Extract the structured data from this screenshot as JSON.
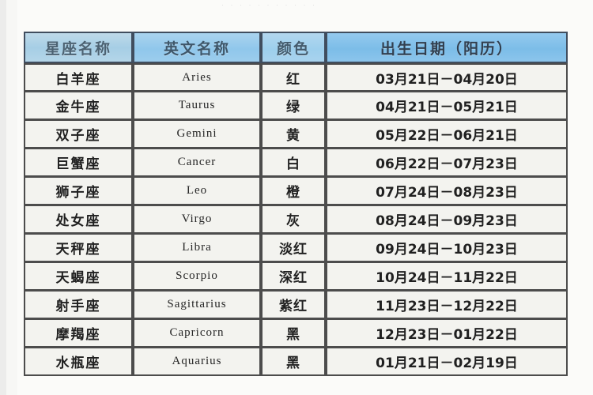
{
  "page": {
    "top_artifact_text": "· · · · ·    · ·    · · · ·",
    "background_color": "#fbfbf9",
    "header_accent_color": "#7dbeea",
    "grid_line_color": "#4a4a4a"
  },
  "table": {
    "headers": {
      "name": "星座名称",
      "english": "英文名称",
      "color": "颜色",
      "date": "出生日期（阳历）"
    },
    "rows": [
      {
        "name": "白羊座",
        "english": "Aries",
        "color": "红",
        "date": "03月21日－04月20日"
      },
      {
        "name": "金牛座",
        "english": "Taurus",
        "color": "绿",
        "date": "04月21日－05月21日"
      },
      {
        "name": "双子座",
        "english": "Gemini",
        "color": "黄",
        "date": "05月22日－06月21日"
      },
      {
        "name": "巨蟹座",
        "english": "Cancer",
        "color": "白",
        "date": "06月22日－07月23日"
      },
      {
        "name": "狮子座",
        "english": "Leo",
        "color": "橙",
        "date": "07月24日－08月23日"
      },
      {
        "name": "处女座",
        "english": "Virgo",
        "color": "灰",
        "date": "08月24日－09月23日"
      },
      {
        "name": "天秤座",
        "english": "Libra",
        "color": "淡红",
        "date": "09月24日－10月23日"
      },
      {
        "name": "天蝎座",
        "english": "Scorpio",
        "color": "深红",
        "date": "10月24日－11月22日"
      },
      {
        "name": "射手座",
        "english": "Sagittarius",
        "color": "紫红",
        "date": "11月23日－12月22日"
      },
      {
        "name": "摩羯座",
        "english": "Capricorn",
        "color": "黑",
        "date": "12月23日－01月22日"
      },
      {
        "name": "水瓶座",
        "english": "Aquarius",
        "color": "黑",
        "date": "01月21日－02月19日"
      }
    ]
  }
}
